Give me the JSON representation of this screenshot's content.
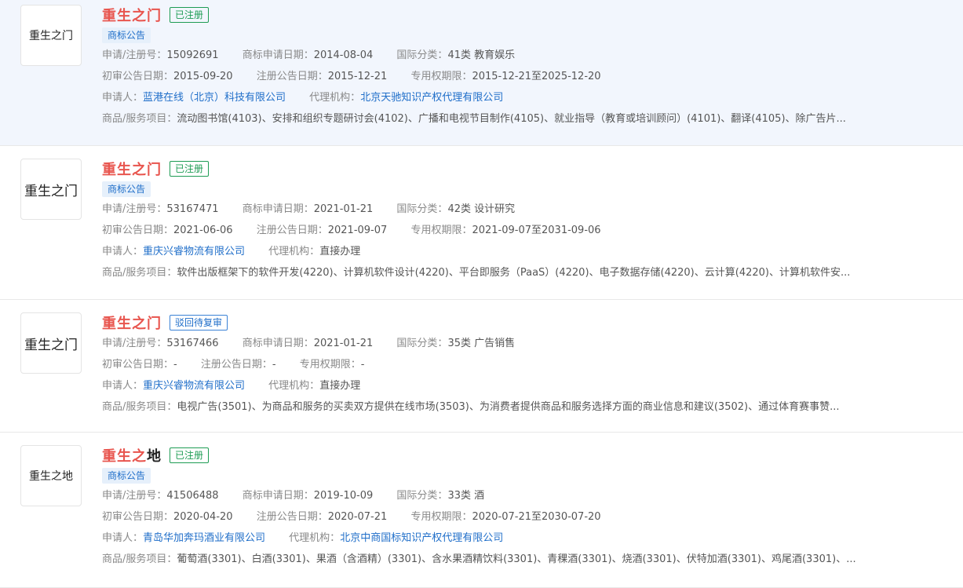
{
  "labels": {
    "reg_no": "申请/注册号：",
    "apply_date": "商标申请日期：",
    "intl_class": "国际分类：",
    "prelim_date": "初审公告日期：",
    "reg_date": "注册公告日期：",
    "exclusive": "专用权期限：",
    "applicant": "申请人：",
    "agency": "代理机构：",
    "goods": "商品/服务项目："
  },
  "items": [
    {
      "logo_text": "重生之门",
      "name_hl": "重生之门",
      "name_rest": "",
      "status": "已注册",
      "tag": "商标公告",
      "reg_no": "15092691",
      "apply_date": "2014-08-04",
      "intl_class": "41类 教育娱乐",
      "prelim_date": "2015-09-20",
      "reg_date": "2015-12-21",
      "exclusive": "2015-12-21至2025-12-20",
      "applicant": "蓝港在线（北京）科技有限公司",
      "agency": "北京天驰知识产权代理有限公司",
      "goods": "流动图书馆(4103)、安排和组织专题研讨会(4102)、广播和电视节目制作(4105)、就业指导（教育或培训顾问）(4101)、翻译(4105)、除广告片..."
    },
    {
      "logo_text": "重生之门",
      "name_hl": "重生之门",
      "name_rest": "",
      "status": "已注册",
      "tag": "商标公告",
      "reg_no": "53167471",
      "apply_date": "2021-01-21",
      "intl_class": "42类 设计研究",
      "prelim_date": "2021-06-06",
      "reg_date": "2021-09-07",
      "exclusive": "2021-09-07至2031-09-06",
      "applicant": "重庆兴睿物流有限公司",
      "agency": "直接办理",
      "goods": "软件出版框架下的软件开发(4220)、计算机软件设计(4220)、平台即服务（PaaS）(4220)、电子数据存储(4220)、云计算(4220)、计算机软件安..."
    },
    {
      "logo_text": "重生之门",
      "name_hl": "重生之门",
      "name_rest": "",
      "status": "驳回待复审",
      "reg_no": "53167466",
      "apply_date": "2021-01-21",
      "intl_class": "35类 广告销售",
      "prelim_date": "-",
      "reg_date": "-",
      "exclusive": "-",
      "applicant": "重庆兴睿物流有限公司",
      "agency": "直接办理",
      "goods": "电视广告(3501)、为商品和服务的买卖双方提供在线市场(3503)、为消费者提供商品和服务选择方面的商业信息和建议(3502)、通过体育赛事赞..."
    },
    {
      "logo_text": "重生之地",
      "name_hl": "重生之",
      "name_rest": "地",
      "status": "已注册",
      "tag": "商标公告",
      "reg_no": "41506488",
      "apply_date": "2019-10-09",
      "intl_class": "33类 酒",
      "prelim_date": "2020-04-20",
      "reg_date": "2020-07-21",
      "exclusive": "2020-07-21至2030-07-20",
      "applicant": "青岛华加奔玛酒业有限公司",
      "agency": "北京中商国标知识产权代理有限公司",
      "goods": "葡萄酒(3301)、白酒(3301)、果酒（含酒精）(3301)、含水果酒精饮料(3301)、青稞酒(3301)、烧酒(3301)、伏特加酒(3301)、鸡尾酒(3301)、..."
    }
  ]
}
